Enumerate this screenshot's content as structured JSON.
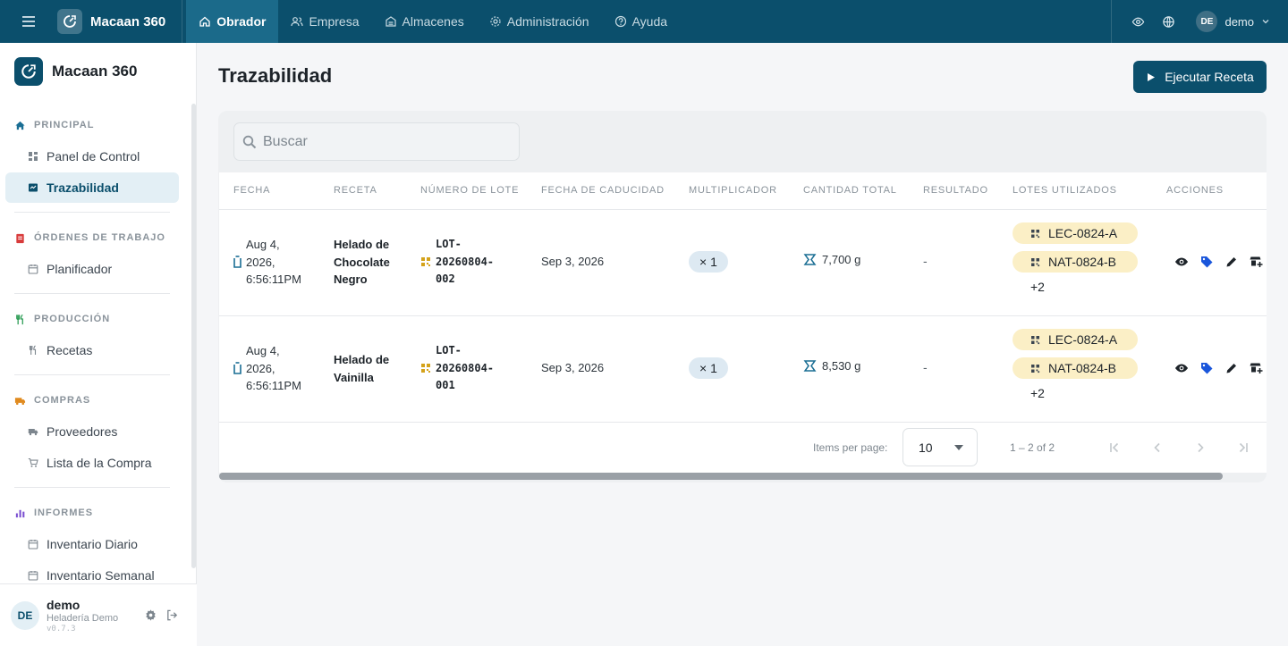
{
  "topbar": {
    "brand": "Macaan 360",
    "nav": [
      {
        "label": "Obrador",
        "icon": "home-icon",
        "active": true
      },
      {
        "label": "Empresa",
        "icon": "users-icon"
      },
      {
        "label": "Almacenes",
        "icon": "warehouse-icon"
      },
      {
        "label": "Administración",
        "icon": "gear-icon"
      },
      {
        "label": "Ayuda",
        "icon": "help-icon"
      }
    ],
    "user_initials": "DE",
    "user_name": "demo"
  },
  "sidebar": {
    "brand": "Macaan 360",
    "sections": [
      {
        "title": "PRINCIPAL",
        "items": [
          "Panel de Control",
          "Trazabilidad"
        ]
      },
      {
        "title": "ÓRDENES DE TRABAJO",
        "items": [
          "Planificador"
        ]
      },
      {
        "title": "PRODUCCIÓN",
        "items": [
          "Recetas"
        ]
      },
      {
        "title": "COMPRAS",
        "items": [
          "Proveedores",
          "Lista de la Compra"
        ]
      },
      {
        "title": "INFORMES",
        "items": [
          "Inventario Diario",
          "Inventario Semanal"
        ]
      }
    ],
    "footer": {
      "initials": "DE",
      "name": "demo",
      "org": "Heladería Demo",
      "version": "v0.7.3"
    }
  },
  "main": {
    "title": "Trazabilidad",
    "primary_button": "Ejecutar Receta",
    "search_placeholder": "Buscar",
    "columns": [
      "FECHA",
      "RECETA",
      "NÚMERO DE LOTE",
      "FECHA DE CADUCIDAD",
      "MULTIPLICADOR",
      "CANTIDAD TOTAL",
      "RESULTADO",
      "LOTES UTILIZADOS",
      "ACCIONES"
    ],
    "rows": [
      {
        "date": [
          "Aug 4,",
          "2026,",
          "6:56:11PM"
        ],
        "recipe": [
          "Helado de",
          "Chocolate",
          "Negro"
        ],
        "lot": [
          "LOT-",
          "20260804-",
          "002"
        ],
        "expiry": "Sep 3, 2026",
        "multiplier": "× 1",
        "total": "7,700 g",
        "result": "-",
        "lots_used": [
          "LEC-0824-A",
          "NAT-0824-B"
        ],
        "lots_more": "+2"
      },
      {
        "date": [
          "Aug 4,",
          "2026,",
          "6:56:11PM"
        ],
        "recipe": [
          "Helado de",
          "Vainilla"
        ],
        "lot": [
          "LOT-",
          "20260804-",
          "001"
        ],
        "expiry": "Sep 3, 2026",
        "multiplier": "× 1",
        "total": "8,530 g",
        "result": "-",
        "lots_used": [
          "LEC-0824-A",
          "NAT-0824-B"
        ],
        "lots_more": "+2"
      }
    ],
    "paginator": {
      "label": "Items per page:",
      "page_size": "10",
      "range": "1 – 2 of 2"
    }
  },
  "colors": {
    "brand": "#0b4f6c",
    "nav_active": "#1b6a8a",
    "chip_lot": "#fbefc6",
    "chip_mult": "#dde9f2",
    "icon_blue": "#1a56db"
  }
}
